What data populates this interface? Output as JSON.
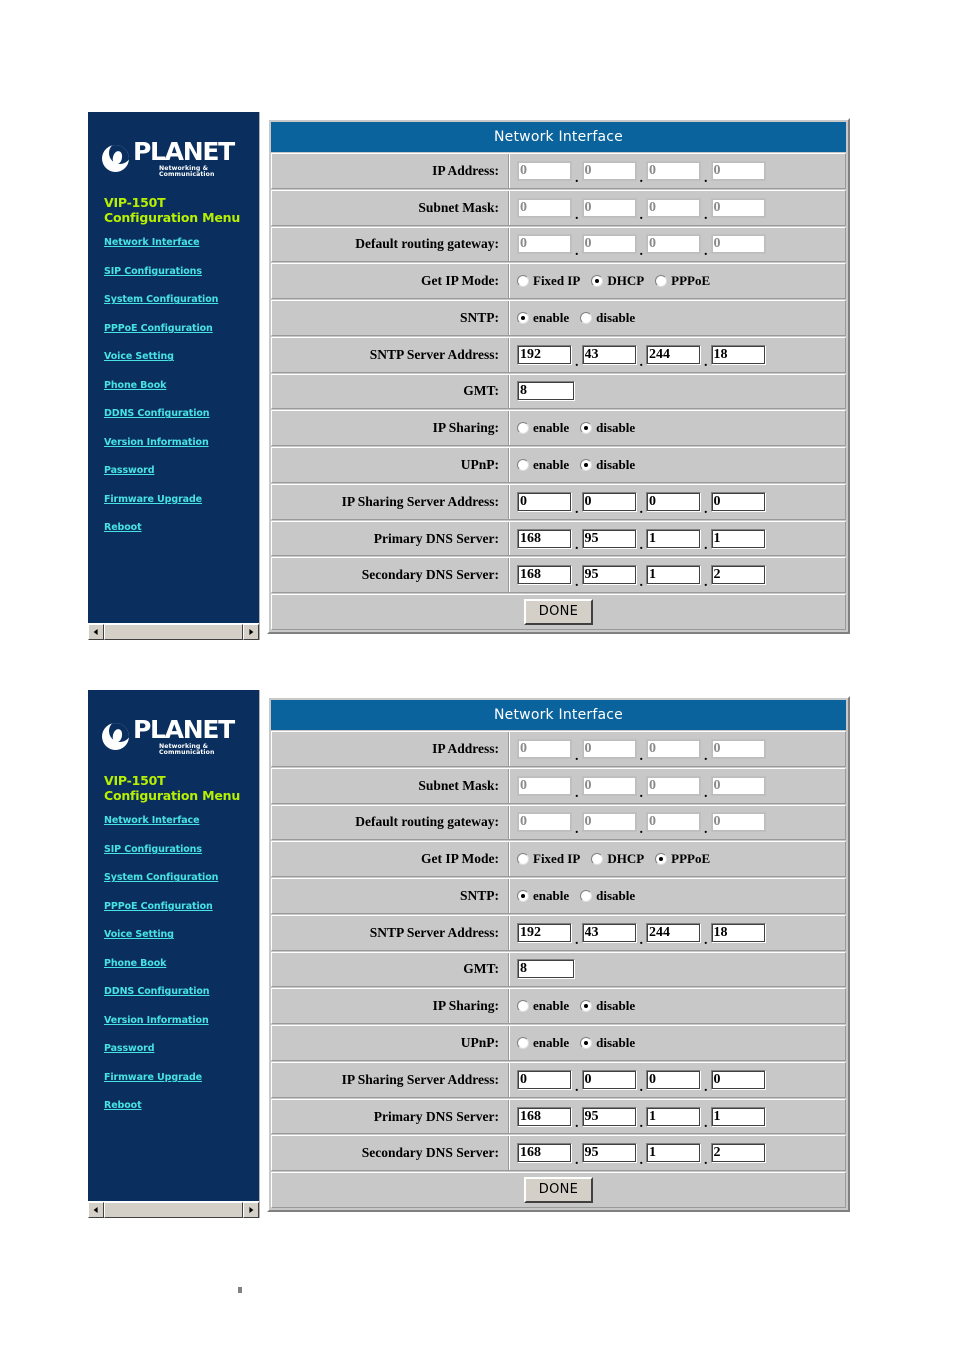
{
  "sidebar": {
    "logo": {
      "name": "PLANET",
      "tagline": "Networking & Communication",
      "mark": "planet-crescent-logo"
    },
    "model": "VIP-150T",
    "menu_heading": "Configuration Menu",
    "items": [
      {
        "label": "Network Interface"
      },
      {
        "label": "SIP Configurations"
      },
      {
        "label": "System Configuration"
      },
      {
        "label": "PPPoE Configuration"
      },
      {
        "label": "Voice Setting"
      },
      {
        "label": "Phone Book"
      },
      {
        "label": "DDNS Configuration"
      },
      {
        "label": "Version Information"
      },
      {
        "label": "Password"
      },
      {
        "label": "Firmware Upgrade"
      },
      {
        "label": "Reboot"
      }
    ],
    "scrollbar": {
      "left_arrow": "◄",
      "right_arrow": "►"
    }
  },
  "colors": {
    "sidebar_bg": "#0a2f5e",
    "title_bar": "#0a639c",
    "form_bg": "#c8c8c8",
    "model_text": "#b7f000",
    "link_text": "#47e3e3"
  },
  "panels": [
    {
      "id": "panel-dhcp",
      "title": "Network Interface",
      "rows": {
        "ip_address": {
          "label": "IP Address:",
          "octets": [
            "0",
            "0",
            "0",
            "0"
          ],
          "disabled": true
        },
        "subnet_mask": {
          "label": "Subnet Mask:",
          "octets": [
            "0",
            "0",
            "0",
            "0"
          ],
          "disabled": true
        },
        "default_gateway": {
          "label": "Default routing gateway:",
          "octets": [
            "0",
            "0",
            "0",
            "0"
          ],
          "disabled": true
        },
        "get_ip_mode": {
          "label": "Get IP Mode:",
          "options": [
            "Fixed IP",
            "DHCP",
            "PPPoE"
          ],
          "selected": "DHCP"
        },
        "sntp": {
          "label": "SNTP:",
          "options": [
            "enable",
            "disable"
          ],
          "selected": "enable"
        },
        "sntp_server": {
          "label": "SNTP Server Address:",
          "octets": [
            "192",
            "43",
            "244",
            "18"
          ],
          "disabled": false
        },
        "gmt": {
          "label": "GMT:",
          "value": "8",
          "disabled": false
        },
        "ip_sharing": {
          "label": "IP Sharing:",
          "options": [
            "enable",
            "disable"
          ],
          "selected": "disable"
        },
        "upnp": {
          "label": "UPnP:",
          "options": [
            "enable",
            "disable"
          ],
          "selected": "disable"
        },
        "ip_sharing_server": {
          "label": "IP Sharing Server Address:",
          "octets": [
            "0",
            "0",
            "0",
            "0"
          ],
          "disabled": false
        },
        "primary_dns": {
          "label": "Primary DNS Server:",
          "octets": [
            "168",
            "95",
            "1",
            "1"
          ],
          "disabled": false
        },
        "secondary_dns": {
          "label": "Secondary DNS Server:",
          "octets": [
            "168",
            "95",
            "1",
            "2"
          ],
          "disabled": false
        }
      },
      "done_label": "DONE"
    },
    {
      "id": "panel-pppoe",
      "title": "Network Interface",
      "rows": {
        "ip_address": {
          "label": "IP Address:",
          "octets": [
            "0",
            "0",
            "0",
            "0"
          ],
          "disabled": true
        },
        "subnet_mask": {
          "label": "Subnet Mask:",
          "octets": [
            "0",
            "0",
            "0",
            "0"
          ],
          "disabled": true
        },
        "default_gateway": {
          "label": "Default routing gateway:",
          "octets": [
            "0",
            "0",
            "0",
            "0"
          ],
          "disabled": true
        },
        "get_ip_mode": {
          "label": "Get IP Mode:",
          "options": [
            "Fixed IP",
            "DHCP",
            "PPPoE"
          ],
          "selected": "PPPoE"
        },
        "sntp": {
          "label": "SNTP:",
          "options": [
            "enable",
            "disable"
          ],
          "selected": "enable"
        },
        "sntp_server": {
          "label": "SNTP Server Address:",
          "octets": [
            "192",
            "43",
            "244",
            "18"
          ],
          "disabled": false
        },
        "gmt": {
          "label": "GMT:",
          "value": "8",
          "disabled": false
        },
        "ip_sharing": {
          "label": "IP Sharing:",
          "options": [
            "enable",
            "disable"
          ],
          "selected": "disable"
        },
        "upnp": {
          "label": "UPnP:",
          "options": [
            "enable",
            "disable"
          ],
          "selected": "disable"
        },
        "ip_sharing_server": {
          "label": "IP Sharing Server Address:",
          "octets": [
            "0",
            "0",
            "0",
            "0"
          ],
          "disabled": false
        },
        "primary_dns": {
          "label": "Primary DNS Server:",
          "octets": [
            "168",
            "95",
            "1",
            "1"
          ],
          "disabled": false
        },
        "secondary_dns": {
          "label": "Secondary DNS Server:",
          "octets": [
            "168",
            "95",
            "1",
            "2"
          ],
          "disabled": false
        }
      },
      "done_label": "DONE"
    }
  ]
}
